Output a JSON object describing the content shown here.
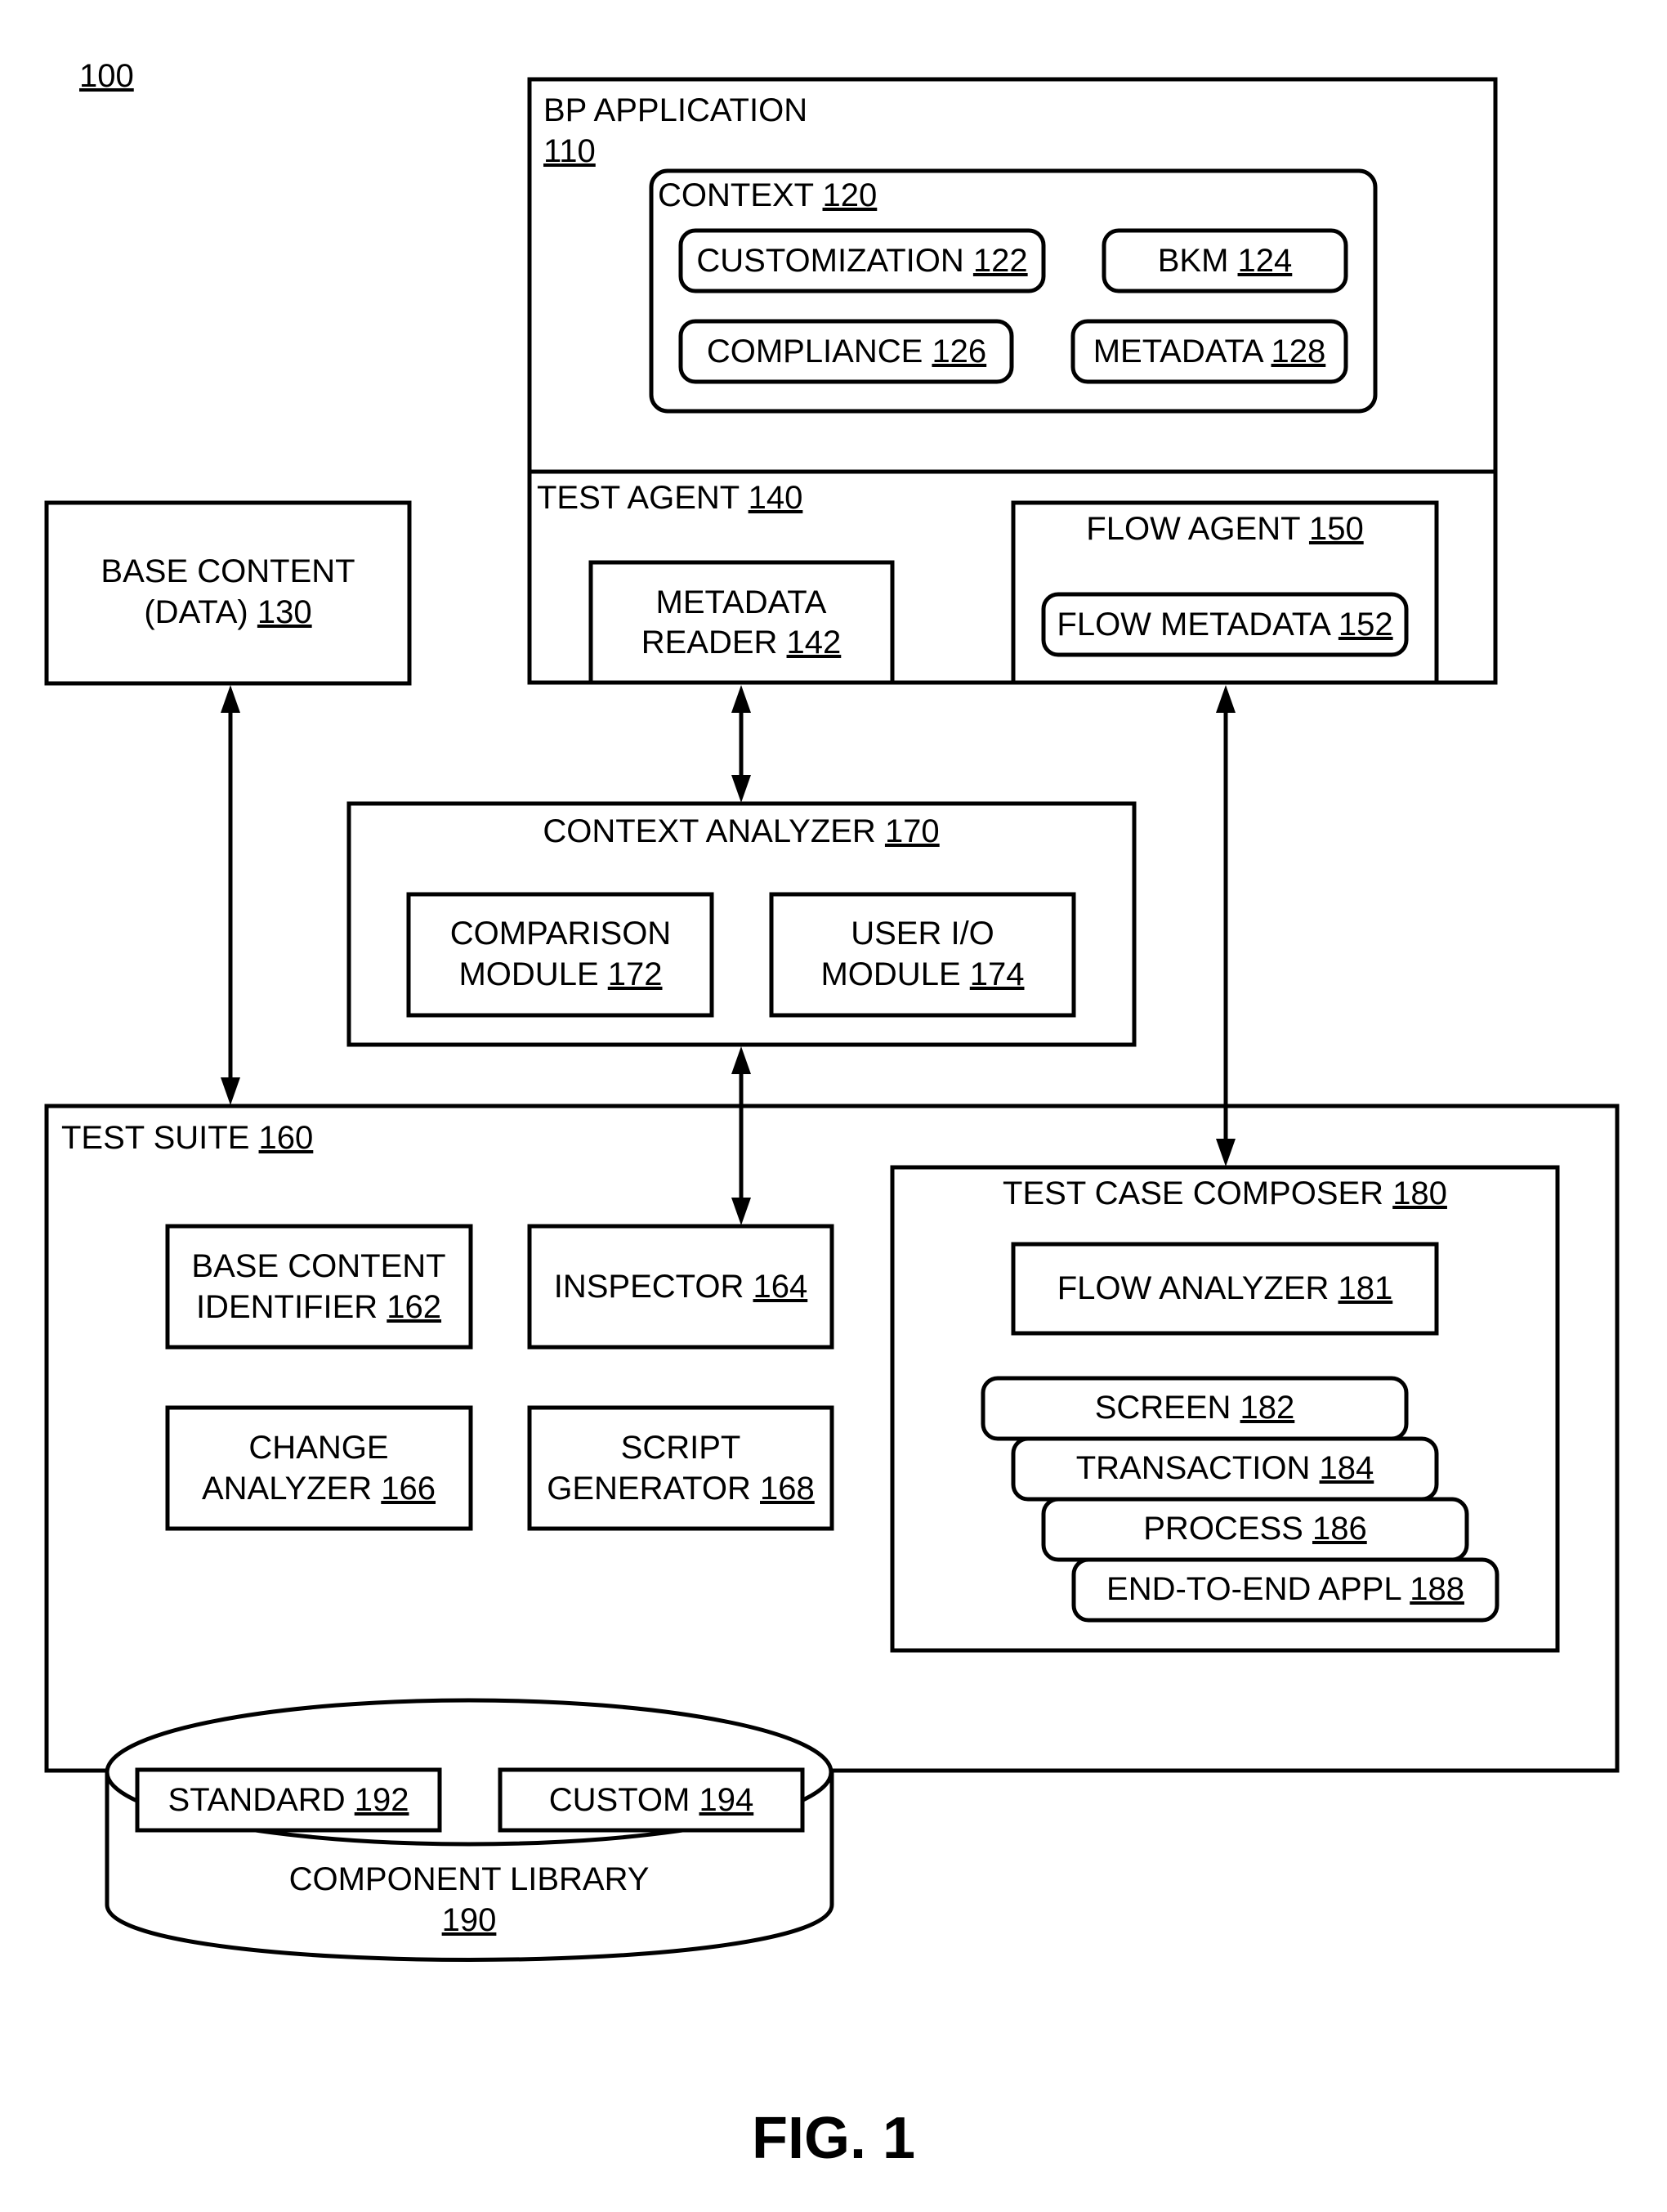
{
  "figure": {
    "ref": "100",
    "caption": "FIG. 1"
  },
  "bp_application": {
    "label": "BP APPLICATION",
    "ref": "110"
  },
  "context": {
    "label": "CONTEXT",
    "ref": "120"
  },
  "customization": {
    "label": "CUSTOMIZATION",
    "ref": "122"
  },
  "bkm": {
    "label": "BKM",
    "ref": "124"
  },
  "compliance": {
    "label": "COMPLIANCE",
    "ref": "126"
  },
  "metadata": {
    "label": "METADATA",
    "ref": "128"
  },
  "base_content": {
    "line1": "BASE CONTENT",
    "line2": "(DATA)",
    "ref": "130"
  },
  "test_agent": {
    "label": "TEST AGENT",
    "ref": "140"
  },
  "metadata_reader": {
    "line1": "METADATA",
    "line2": "READER",
    "ref": "142"
  },
  "flow_agent": {
    "label": "FLOW AGENT",
    "ref": "150"
  },
  "flow_metadata": {
    "label": "FLOW METADATA",
    "ref": "152"
  },
  "test_suite": {
    "label": "TEST SUITE",
    "ref": "160"
  },
  "base_content_identifier": {
    "line1": "BASE CONTENT",
    "line2": "IDENTIFIER",
    "ref": "162"
  },
  "inspector": {
    "label": "INSPECTOR",
    "ref": "164"
  },
  "change_analyzer": {
    "line1": "CHANGE",
    "line2": "ANALYZER",
    "ref": "166"
  },
  "script_generator": {
    "line1": "SCRIPT",
    "line2": "GENERATOR",
    "ref": "168"
  },
  "context_analyzer": {
    "label": "CONTEXT ANALYZER",
    "ref": "170"
  },
  "comparison_module": {
    "line1": "COMPARISON",
    "line2": "MODULE",
    "ref": "172"
  },
  "user_io_module": {
    "line1": "USER I/O",
    "line2": "MODULE",
    "ref": "174"
  },
  "test_case_composer": {
    "label": "TEST CASE COMPOSER",
    "ref": "180"
  },
  "flow_analyzer": {
    "label": "FLOW ANALYZER",
    "ref": "181"
  },
  "screen": {
    "label": "SCREEN",
    "ref": "182"
  },
  "transaction": {
    "label": "TRANSACTION",
    "ref": "184"
  },
  "process": {
    "label": "PROCESS",
    "ref": "186"
  },
  "end_to_end": {
    "label": "END-TO-END APPL",
    "ref": "188"
  },
  "component_library": {
    "label": "COMPONENT LIBRARY",
    "ref": "190"
  },
  "standard": {
    "label": "STANDARD",
    "ref": "192"
  },
  "custom": {
    "label": "CUSTOM",
    "ref": "194"
  }
}
